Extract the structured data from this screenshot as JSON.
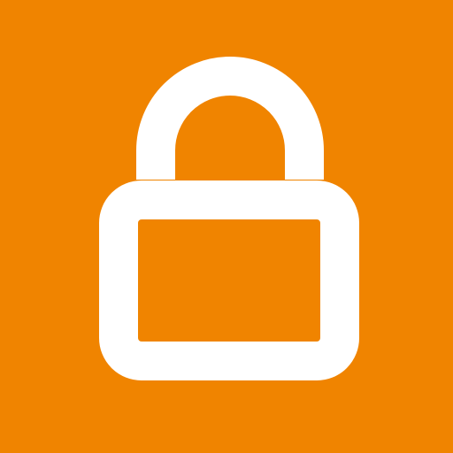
{
  "icon": {
    "name": "lock-icon",
    "background_color": "#F08400",
    "foreground_color": "#FFFFFF"
  }
}
